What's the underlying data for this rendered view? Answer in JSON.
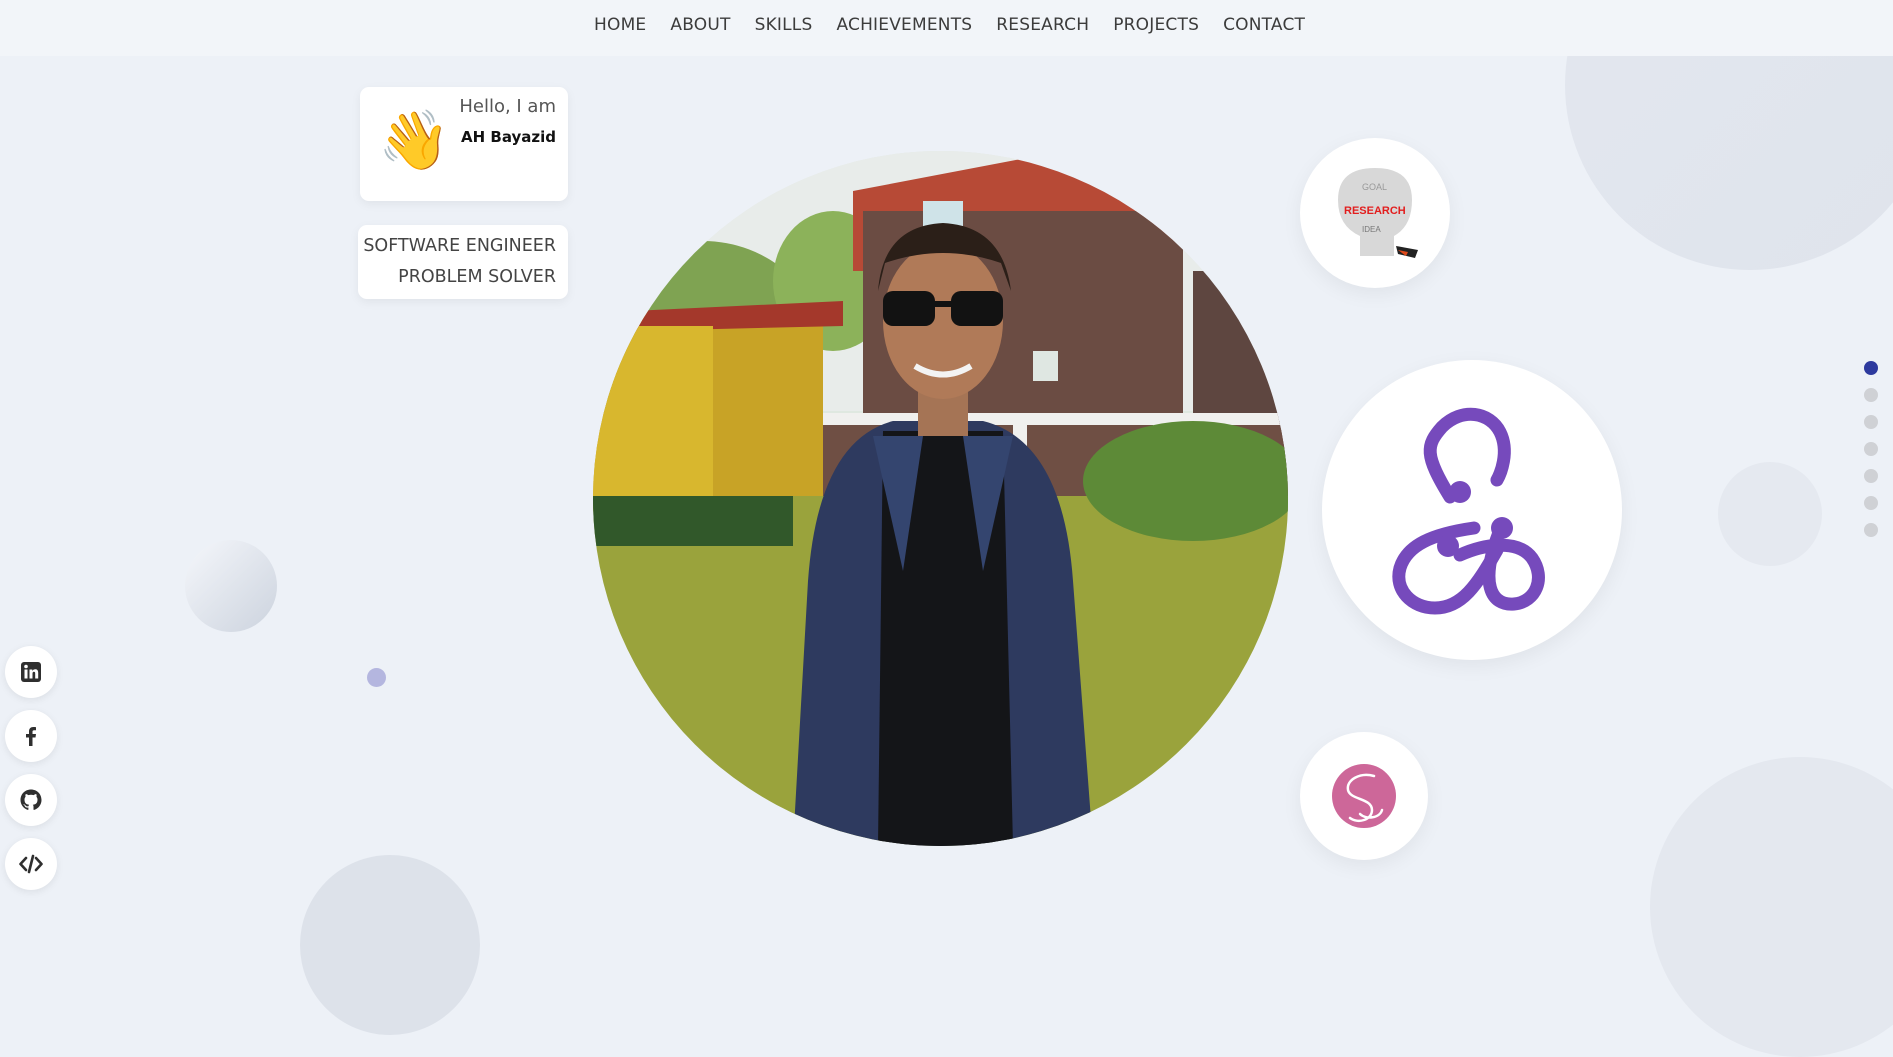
{
  "nav": {
    "items": [
      "HOME",
      "ABOUT",
      "SKILLS",
      "ACHIEVEMENTS",
      "RESEARCH",
      "PROJECTS",
      "CONTACT"
    ]
  },
  "hero": {
    "greeting": "Hello, I am",
    "name": "AH Bayazid",
    "roles": [
      "SOFTWARE ENGINEER",
      "PROBLEM SOLVER"
    ],
    "wave_emoji": "👋",
    "photo": "profile-photo"
  },
  "bubbles": {
    "research_logo_text": "RESEARCH",
    "icons": [
      "research-word-cloud",
      "redux-logo-icon",
      "sass-logo-icon"
    ],
    "redux_color": "#764abc",
    "sass_color": "#cd6799"
  },
  "pager": {
    "count": 7,
    "active_index": 0,
    "active_color": "#2d3a9e"
  },
  "social": {
    "icons": [
      "linkedin-icon",
      "facebook-icon",
      "github-icon",
      "code-icon"
    ]
  }
}
